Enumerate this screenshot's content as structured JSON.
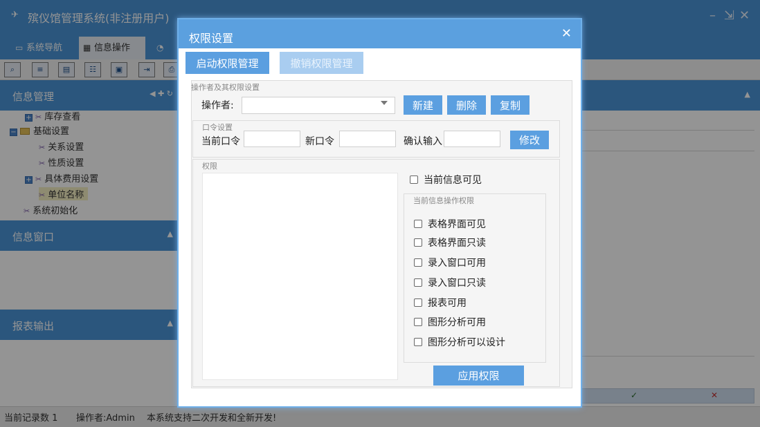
{
  "app": {
    "title": "殡仪馆管理系统(非注册用户)",
    "window_controls": [
      "–",
      "⇲",
      "✕"
    ]
  },
  "tabs": [
    {
      "label": "系统导航",
      "icon": "window-icon"
    },
    {
      "label": "信息操作",
      "icon": "grid-icon"
    },
    {
      "label": "",
      "icon": "help-icon"
    }
  ],
  "sidebar": {
    "sections": [
      {
        "title": "信息管理"
      },
      {
        "title": "信息窗口"
      },
      {
        "title": "报表输出"
      }
    ],
    "tree": [
      {
        "label": "库存查看"
      },
      {
        "label": "基础设置"
      },
      {
        "label": "关系设置"
      },
      {
        "label": "性质设置"
      },
      {
        "label": "具体费用设置"
      },
      {
        "label": "单位名称"
      },
      {
        "label": "系统初始化"
      }
    ]
  },
  "grid_footer": {
    "ok": "✓",
    "cancel": "✕"
  },
  "status": {
    "records": "当前记录数 1",
    "operator": "操作者:Admin",
    "message": "本系统支持二次开发和全新开发!"
  },
  "dialog": {
    "title": "权限设置",
    "close": "✕",
    "enable_label": "启动权限管理",
    "revoke_label": "撤销权限管理",
    "operator_section": "操作者及其权限设置",
    "operator_label": "操作者:",
    "operator_value": "",
    "new_label": "新建",
    "delete_label": "删除",
    "copy_label": "复制",
    "password_section": "口令设置",
    "current_pw_label": "当前口令",
    "new_pw_label": "新口令",
    "confirm_pw_label": "确认输入",
    "modify_label": "修改",
    "permission_section": "权限",
    "current_visible_label": "当前信息可见",
    "current_ops_section": "当前信息操作权限",
    "options": [
      {
        "label": "表格界面可见",
        "checked": false
      },
      {
        "label": "表格界面只读",
        "checked": false
      },
      {
        "label": "录入窗口可用",
        "checked": false
      },
      {
        "label": "录入窗口只读",
        "checked": false
      },
      {
        "label": "报表可用",
        "checked": false
      },
      {
        "label": "图形分析可用",
        "checked": false
      },
      {
        "label": "图形分析可以设计",
        "checked": false
      }
    ],
    "apply_label": "应用权限"
  }
}
